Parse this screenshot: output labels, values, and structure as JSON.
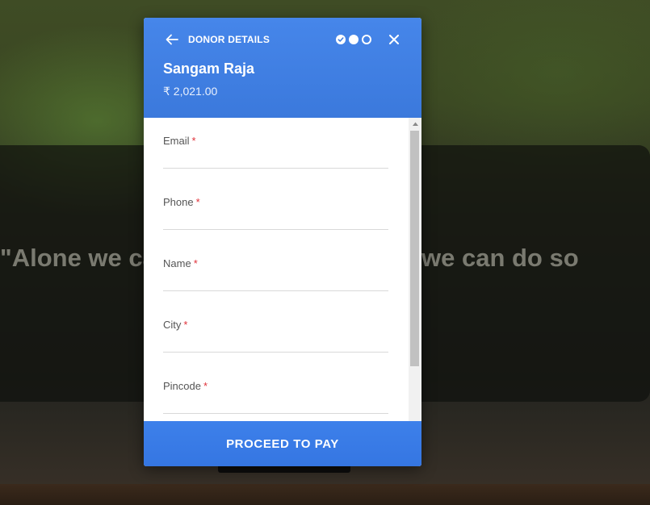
{
  "background": {
    "quote_left": "\"Alone we ca",
    "quote_right": "we can do so"
  },
  "modal": {
    "header": {
      "title": "DONOR DETAILS",
      "donor_name": "Sangam Raja",
      "amount": "₹ 2,021.00",
      "steps": [
        "done",
        "current",
        "pending"
      ]
    },
    "fields": [
      {
        "label": "Email",
        "required_mark": "*",
        "value": ""
      },
      {
        "label": "Phone",
        "required_mark": "*",
        "value": ""
      },
      {
        "label": "Name",
        "required_mark": "*",
        "value": ""
      },
      {
        "label": "City",
        "required_mark": "*",
        "value": ""
      },
      {
        "label": "Pincode",
        "required_mark": "*",
        "value": ""
      }
    ],
    "proceed_label": "PROCEED TO PAY"
  },
  "colors": {
    "header_blue": "#4686ea",
    "button_blue": "#3d80ea",
    "required_red": "#e0323a"
  },
  "icons": {
    "back": "arrow-left-icon",
    "close": "close-icon",
    "step_done": "check-circle-icon"
  }
}
